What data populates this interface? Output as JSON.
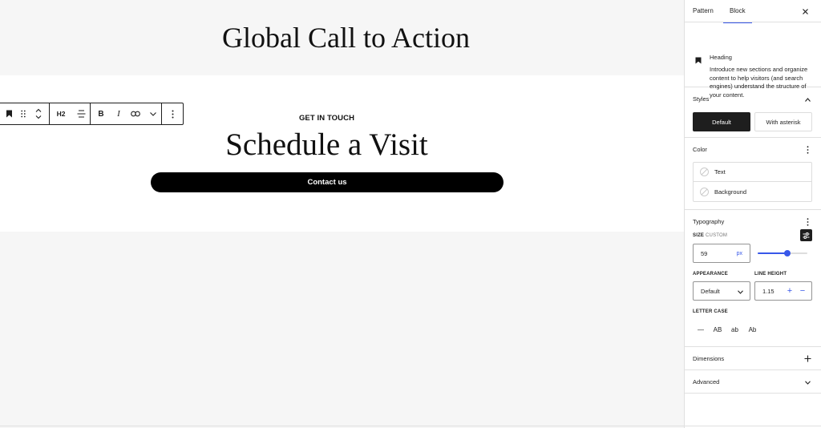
{
  "canvas": {
    "pattern_title": "Global Call to Action",
    "eyebrow": "GET IN TOUCH",
    "heading": "Schedule a Visit",
    "button_label": "Contact us"
  },
  "toolbar": {
    "heading_level": "H2",
    "bold": "B",
    "italic": "I"
  },
  "sidebar": {
    "tabs": {
      "pattern": "Pattern",
      "block": "Block"
    },
    "block_card": {
      "name": "Heading",
      "description": "Introduce new sections and organize content to help visitors (and search engines) understand the structure of your content."
    },
    "styles": {
      "title": "Styles",
      "options": [
        "Default",
        "With asterisk"
      ],
      "selected": "Default"
    },
    "color": {
      "title": "Color",
      "items": [
        "Text",
        "Background"
      ]
    },
    "typography": {
      "title": "Typography",
      "size_label": "SIZE",
      "size_mode": "CUSTOM",
      "size_value": "59",
      "size_unit": "px",
      "size_slider_fraction": 0.6,
      "appearance_label": "APPEARANCE",
      "appearance_value": "Default",
      "line_height_label": "LINE HEIGHT",
      "line_height_value": "1.15",
      "letter_case_label": "LETTER CASE",
      "letter_case_options": [
        "—",
        "AB",
        "ab",
        "Ab"
      ]
    },
    "dimensions": {
      "title": "Dimensions"
    },
    "advanced": {
      "title": "Advanced"
    }
  },
  "colors": {
    "accent": "#3858e9",
    "dark": "#1e1e1e",
    "canvas_bg": "#f6f6f6"
  }
}
